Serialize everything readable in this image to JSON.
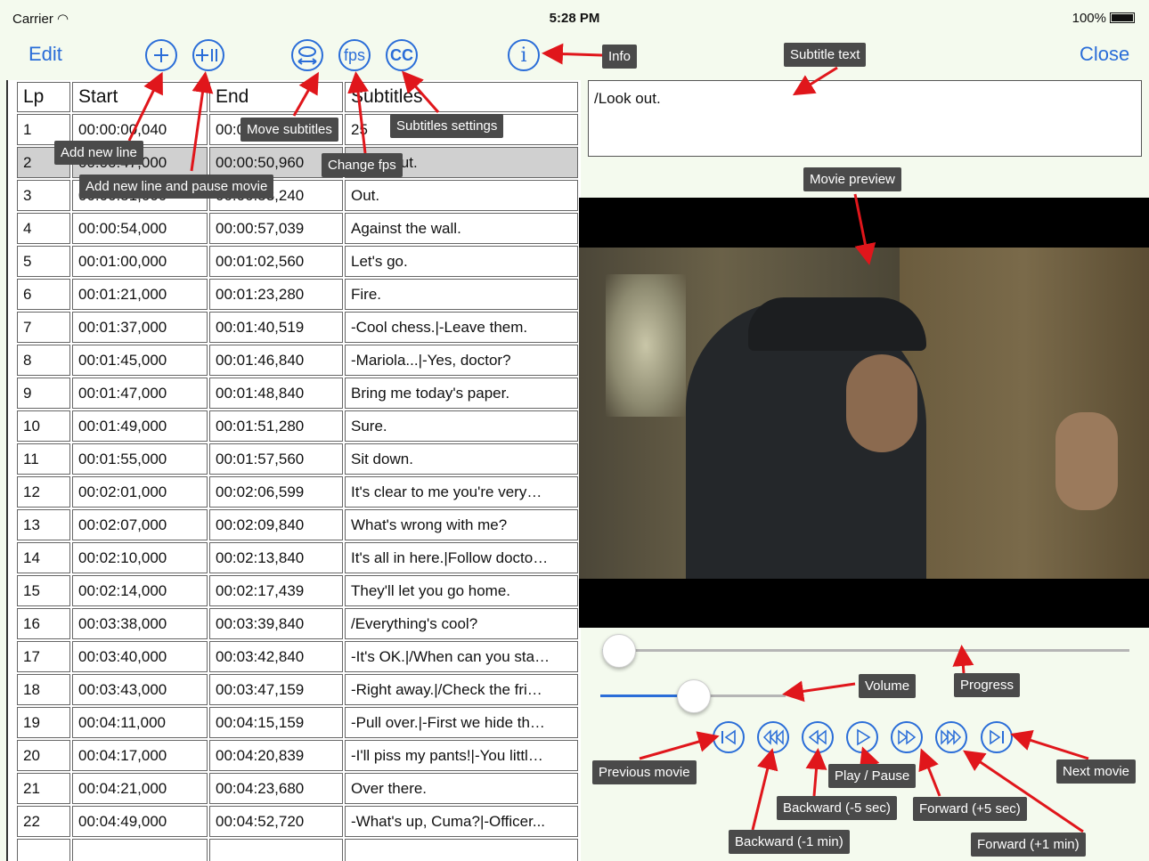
{
  "status": {
    "carrier": "Carrier",
    "time": "5:28 PM",
    "battery": "100%"
  },
  "toolbar": {
    "edit_label": "Edit",
    "close_label": "Close",
    "add_icon": "plus-icon",
    "add_pause_icon": "plus-pause-icon",
    "move_icon": "move-subtitles-icon",
    "fps_label": "fps",
    "cc_label": "CC",
    "info_label": "i"
  },
  "table": {
    "headers": [
      "Lp",
      "Start",
      "End",
      "Subtitles"
    ],
    "selected_row": 2,
    "rows": [
      [
        "1",
        "00:00:00,040",
        "00:00:01,440",
        "25"
      ],
      [
        "2",
        "00:00:47,000",
        "00:00:50,960",
        "/Look out."
      ],
      [
        "3",
        "00:00:51,000",
        "00:00:53,240",
        "Out."
      ],
      [
        "4",
        "00:00:54,000",
        "00:00:57,039",
        "Against the wall."
      ],
      [
        "5",
        "00:01:00,000",
        "00:01:02,560",
        "Let's go."
      ],
      [
        "6",
        "00:01:21,000",
        "00:01:23,280",
        "Fire."
      ],
      [
        "7",
        "00:01:37,000",
        "00:01:40,519",
        "-Cool chess.|-Leave them."
      ],
      [
        "8",
        "00:01:45,000",
        "00:01:46,840",
        "-Mariola...|-Yes, doctor?"
      ],
      [
        "9",
        "00:01:47,000",
        "00:01:48,840",
        "Bring me today's paper."
      ],
      [
        "10",
        "00:01:49,000",
        "00:01:51,280",
        "Sure."
      ],
      [
        "11",
        "00:01:55,000",
        "00:01:57,560",
        "Sit down."
      ],
      [
        "12",
        "00:02:01,000",
        "00:02:06,599",
        "It's clear to me you're very…"
      ],
      [
        "13",
        "00:02:07,000",
        "00:02:09,840",
        "What's wrong with me?"
      ],
      [
        "14",
        "00:02:10,000",
        "00:02:13,840",
        "It's all in here.|Follow docto…"
      ],
      [
        "15",
        "00:02:14,000",
        "00:02:17,439",
        "They'll let you go home."
      ],
      [
        "16",
        "00:03:38,000",
        "00:03:39,840",
        "/Everything's cool?"
      ],
      [
        "17",
        "00:03:40,000",
        "00:03:42,840",
        "-It's OK.|/When can you sta…"
      ],
      [
        "18",
        "00:03:43,000",
        "00:03:47,159",
        "-Right away.|/Check the fri…"
      ],
      [
        "19",
        "00:04:11,000",
        "00:04:15,159",
        "-Pull over.|-First we hide th…"
      ],
      [
        "20",
        "00:04:17,000",
        "00:04:20,839",
        "-I'll piss my pants!|-You littl…"
      ],
      [
        "21",
        "00:04:21,000",
        "00:04:23,680",
        "Over there."
      ],
      [
        "22",
        "00:04:49,000",
        "00:04:52,720",
        "-What's up, Cuma?|-Officer..."
      ],
      [
        "",
        "",
        "",
        ""
      ]
    ]
  },
  "subtitle_text": "/Look out.",
  "player": {
    "progress": 0.0,
    "volume": 0.5,
    "controls": [
      "previous-movie-icon",
      "backward-1min-icon",
      "backward-5sec-icon",
      "play-pause-icon",
      "forward-5sec-icon",
      "forward-1min-icon",
      "next-movie-icon"
    ]
  },
  "callouts": {
    "info": "Info",
    "subtitle_text": "Subtitle text",
    "add_new_line": "Add new line",
    "add_new_line_pause": "Add new line and pause movie",
    "move_subtitles": "Move subtitles",
    "change_fps": "Change fps",
    "subtitles_settings": "Subtitles settings",
    "movie_preview": "Movie preview",
    "volume": "Volume",
    "progress": "Progress",
    "previous_movie": "Previous movie",
    "next_movie": "Next movie",
    "play_pause": "Play / Pause",
    "backward_5": "Backward (-5 sec)",
    "forward_5": "Forward (+5 sec)",
    "backward_1": "Backward (-1 min)",
    "forward_1": "Forward (+1 min)"
  },
  "colors": {
    "accent": "#2a6dd8",
    "callout_bg": "#4a4a4a",
    "arrow": "#e0161b",
    "background": "#f4faee"
  }
}
